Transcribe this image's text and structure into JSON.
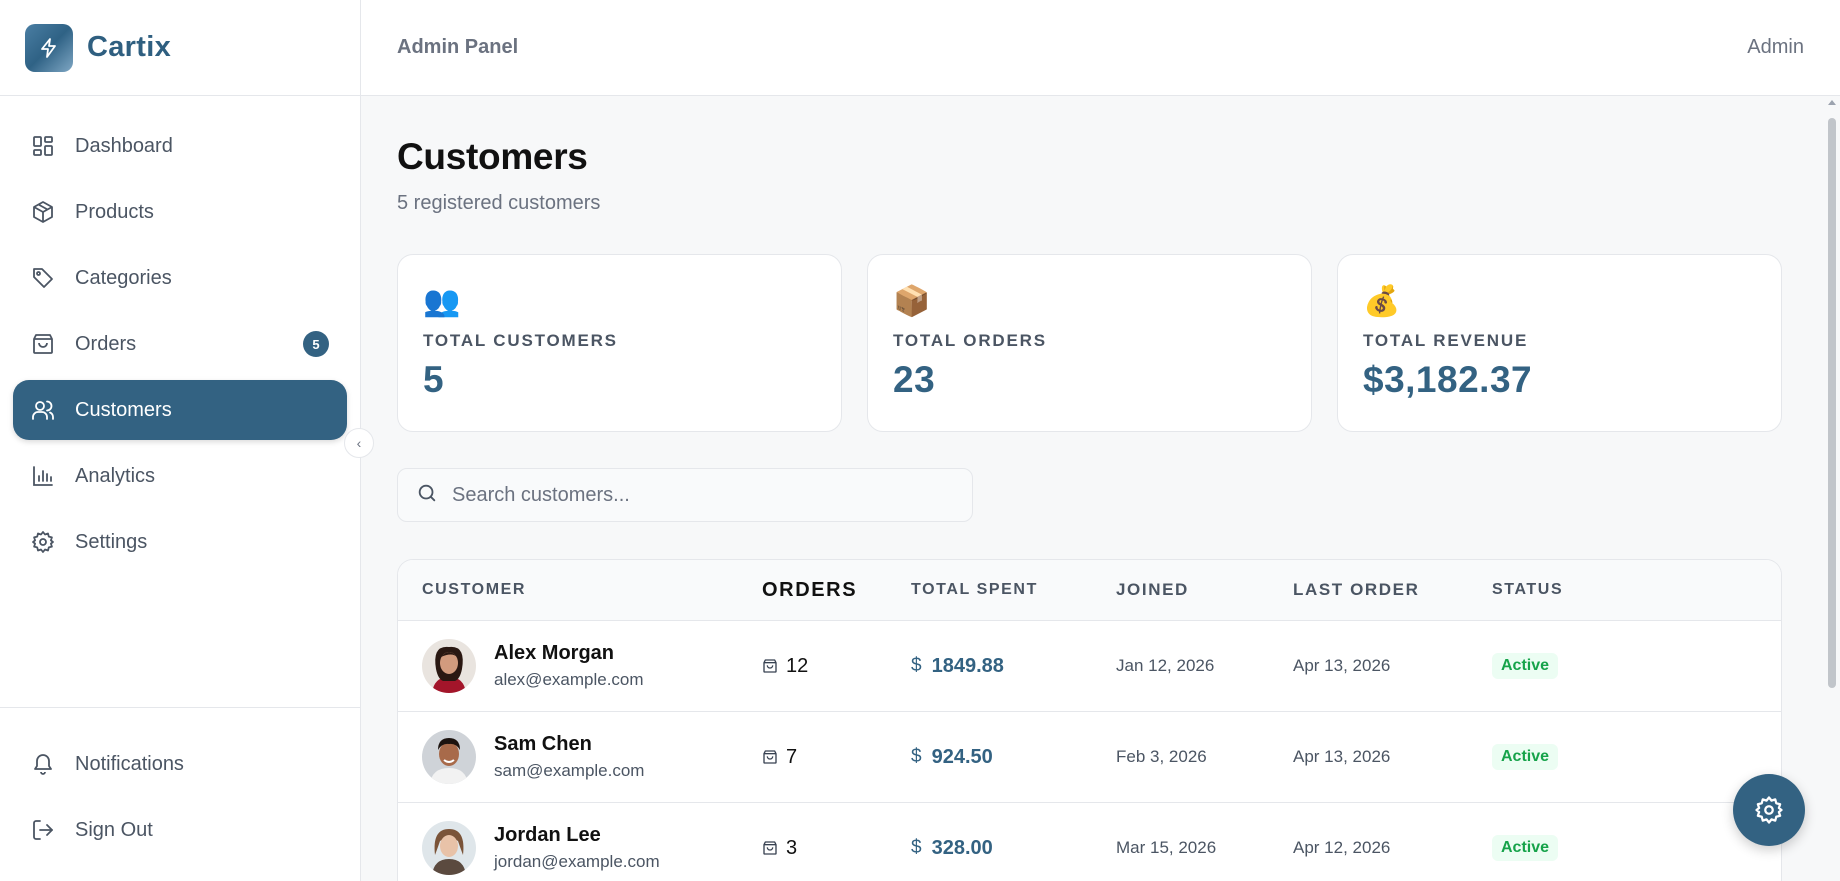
{
  "brand": {
    "name": "Cartix",
    "logo_icon": "bolt-icon"
  },
  "header": {
    "title": "Admin Panel",
    "user": "Admin"
  },
  "sidebar": {
    "items": [
      {
        "label": "Dashboard",
        "icon": "dashboard-icon"
      },
      {
        "label": "Products",
        "icon": "box-icon"
      },
      {
        "label": "Categories",
        "icon": "tag-icon"
      },
      {
        "label": "Orders",
        "icon": "shopping-bag-icon",
        "badge": "5"
      },
      {
        "label": "Customers",
        "icon": "users-icon",
        "active": true
      },
      {
        "label": "Analytics",
        "icon": "bar-chart-icon"
      },
      {
        "label": "Settings",
        "icon": "gear-icon"
      }
    ],
    "bottom": [
      {
        "label": "Notifications",
        "icon": "bell-icon"
      },
      {
        "label": "Sign Out",
        "icon": "sign-out-icon"
      }
    ]
  },
  "page": {
    "title": "Customers",
    "subtitle": "5 registered customers"
  },
  "stats": [
    {
      "emoji": "👥",
      "label": "TOTAL CUSTOMERS",
      "value": "5"
    },
    {
      "emoji": "📦",
      "label": "TOTAL ORDERS",
      "value": "23"
    },
    {
      "emoji": "💰",
      "label": "TOTAL REVENUE",
      "value": "$3,182.37"
    }
  ],
  "search": {
    "placeholder": "Search customers...",
    "value": ""
  },
  "table": {
    "columns": [
      "CUSTOMER",
      "ORDERS",
      "TOTAL SPENT",
      "JOINED",
      "LAST ORDER",
      "STATUS"
    ],
    "rows": [
      {
        "name": "Alex Morgan",
        "email": "alex@example.com",
        "orders": "12",
        "currency": "$",
        "spent": "1849.88",
        "joined": "Jan 12, 2026",
        "last_order": "Apr 13, 2026",
        "status": "Active"
      },
      {
        "name": "Sam Chen",
        "email": "sam@example.com",
        "orders": "7",
        "currency": "$",
        "spent": "924.50",
        "joined": "Feb 3, 2026",
        "last_order": "Apr 13, 2026",
        "status": "Active"
      },
      {
        "name": "Jordan Lee",
        "email": "jordan@example.com",
        "orders": "3",
        "currency": "$",
        "spent": "328.00",
        "joined": "Mar 15, 2026",
        "last_order": "Apr 12, 2026",
        "status": "Active"
      }
    ]
  },
  "colors": {
    "accent": "#336282",
    "status_active": "#16a34a",
    "status_active_bg": "#ecfdf3"
  }
}
